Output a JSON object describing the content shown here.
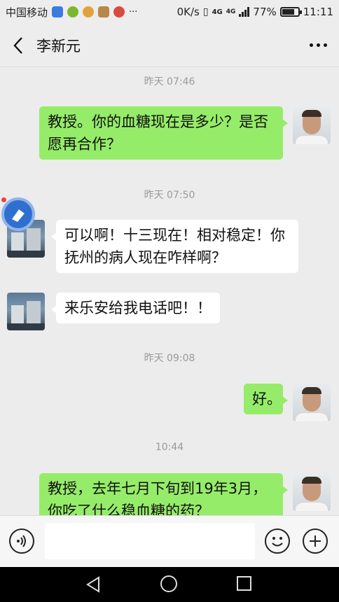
{
  "status_bar": {
    "carrier": "中国移动",
    "more": "···",
    "net_speed": "0K/s",
    "net_type_1": "4G",
    "net_type_2": "4G",
    "battery_percent": "77%",
    "battery_level": 0.77,
    "time": "11:11"
  },
  "header": {
    "title": "李新元"
  },
  "messages": [
    {
      "kind": "time",
      "text": "昨天 07:46"
    },
    {
      "kind": "self",
      "text": "教授。你的血糖现在是多少？是否愿再合作？"
    },
    {
      "kind": "time",
      "text": "昨天 07:50"
    },
    {
      "kind": "other",
      "text": "可以啊！十三现在！相对稳定！你抚州的病人现在咋样啊？"
    },
    {
      "kind": "other",
      "text": "来乐安给我电话吧！！"
    },
    {
      "kind": "time",
      "text": "昨天 09:08"
    },
    {
      "kind": "self",
      "text": "好。"
    },
    {
      "kind": "time",
      "text": "10:44"
    },
    {
      "kind": "self",
      "text": "教授，去年七月下旬到19年3月，你吃了什么稳血糖的药？"
    }
  ],
  "input": {
    "value": ""
  },
  "colors": {
    "self_bubble": "#95ec69",
    "other_bubble": "#ffffff",
    "background": "#ececec"
  },
  "icons": {
    "back": "chevron-left-icon",
    "more": "more-dots-icon",
    "voice": "voice-icon",
    "emoji": "emoji-icon",
    "plus": "plus-icon",
    "float": "floating-assistant-icon",
    "nav_back": "nav-back-icon",
    "nav_home": "nav-home-icon",
    "nav_recent": "nav-recent-icon"
  }
}
